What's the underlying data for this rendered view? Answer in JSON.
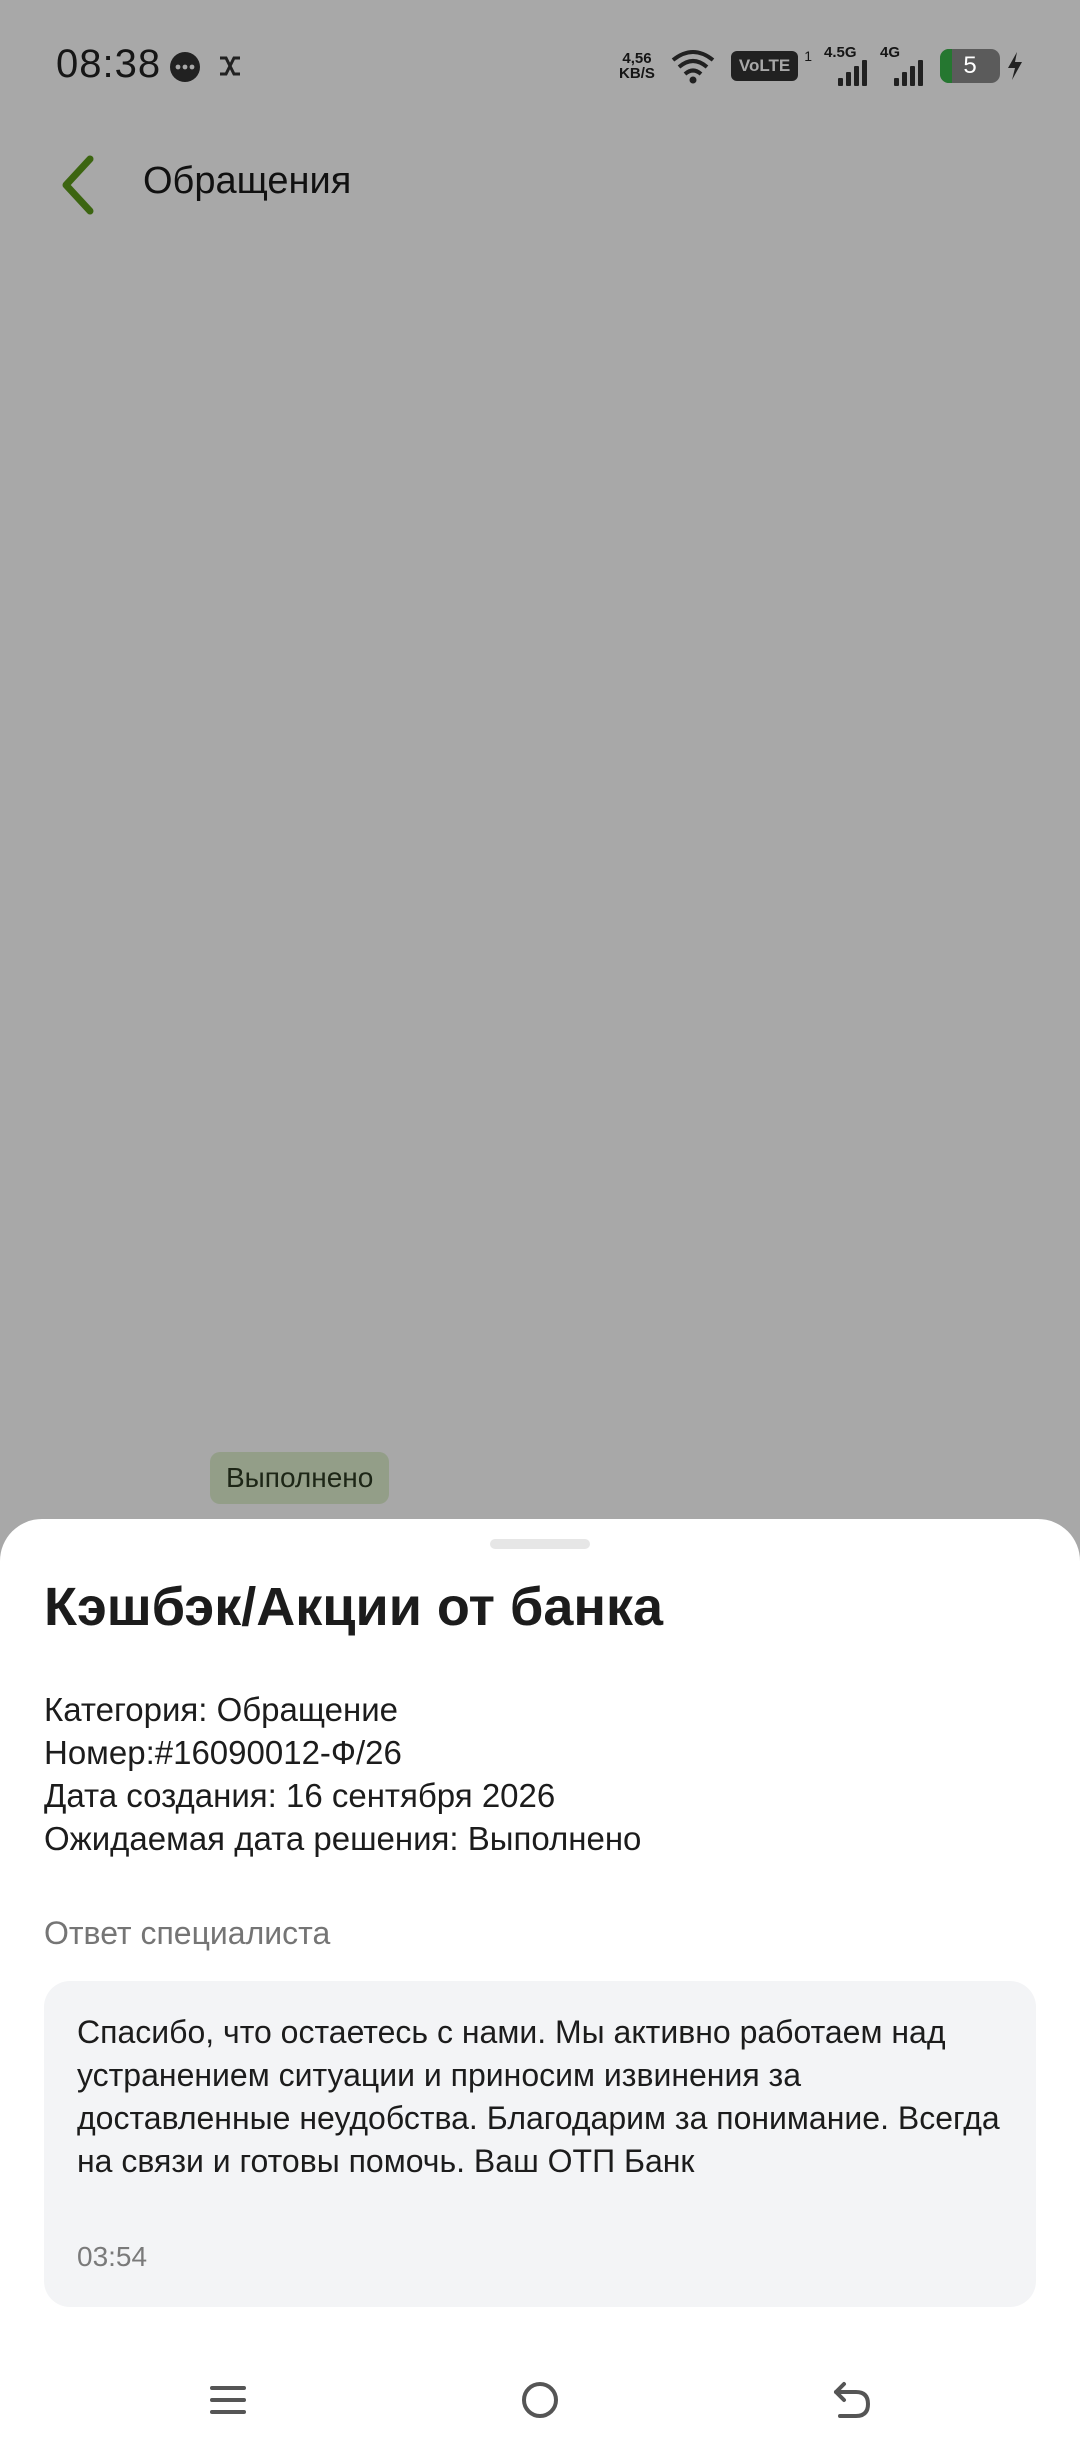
{
  "status_bar": {
    "time": "08:38",
    "net_speed_value": "4,56",
    "net_speed_unit": "KB/S",
    "volte": "VoLTE",
    "volte_sim": "1",
    "signal_1_label": "4.5G",
    "signal_2_label": "4G",
    "battery_level": "5",
    "battery_fraction": 0.05,
    "colors": {
      "battery_fill": "#39b54a"
    }
  },
  "header": {
    "title": "Обращения",
    "back_icon": "chevron-left-icon",
    "accent_color": "#5c9a1b"
  },
  "background_card": {
    "status_badge": "Выполнено"
  },
  "sheet": {
    "title": "Кэшбэк/Акции от банка",
    "category": "Категория: Обращение",
    "number": "Номер:#16090012-Ф/26",
    "created": "Дата создания: 16 сентября 2026",
    "expected": "Ожидаемая дата решения: Выполнено",
    "answer_label": "Ответ специалиста",
    "answer_text": "Спасибо, что остаетесь с нами. Мы активно работаем над устранением ситуации и приносим извинения за доставленные неудобства. Благодарим за понимание. Всегда на связи и готовы помочь. Ваш ОТП Банк",
    "answer_time": "03:54"
  },
  "nav_bar": {
    "icons": [
      "menu-icon",
      "home-icon",
      "back-icon"
    ]
  }
}
